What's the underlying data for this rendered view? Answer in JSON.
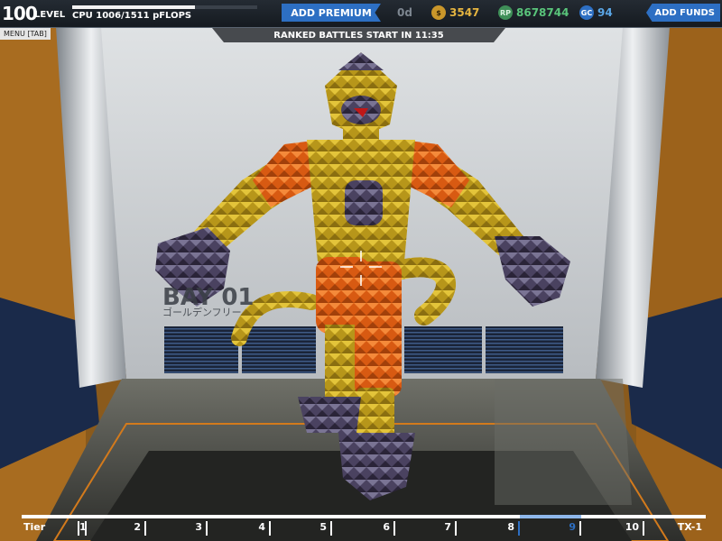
{
  "topbar": {
    "level_number": "100",
    "level_label": "LEVEL",
    "cpu_text": "CPU 1006/1511 pFLOPS",
    "cpu_fraction": 0.665,
    "premium_button": "ADD PREMIUM",
    "premium_days": "0d",
    "robits_value": "3547",
    "rp_value": "8678744",
    "gc_value": "94",
    "funds_button": "ADD FUNDS"
  },
  "menu": {
    "label": "MENU [TAB]"
  },
  "banner": {
    "timer_text": "RANKED BATTLES START IN 11:35"
  },
  "bay": {
    "label": "BAY 01",
    "sublabel": "ゴールデンフリー"
  },
  "tiers": {
    "first_label": "Tier",
    "labels": [
      "1",
      "2",
      "3",
      "4",
      "5",
      "6",
      "7",
      "8",
      "9",
      "10",
      "TX-1"
    ],
    "selected": "9"
  },
  "colors": {
    "accent": "#2d6fc3",
    "robot_yellow": "#c9a81e",
    "robot_orange": "#e8661a",
    "robot_purple": "#4a4260"
  }
}
